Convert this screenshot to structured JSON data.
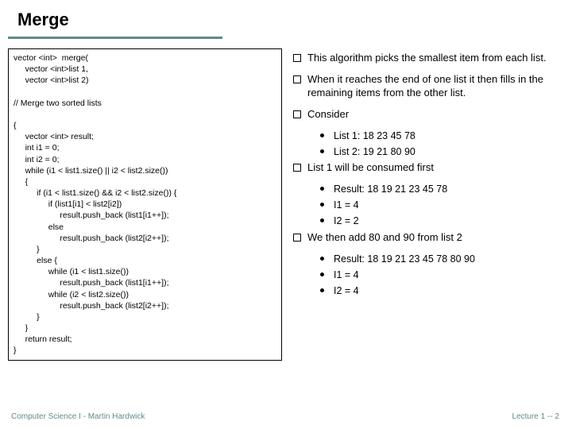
{
  "title": "Merge",
  "code": "vector <int>  merge(\n     vector <int>list 1,\n     vector <int>list 2)\n\n// Merge two sorted lists\n\n{\n     vector <int> result;\n     int i1 = 0;\n     int i2 = 0;\n     while (i1 < list1.size() || i2 < list2.size())\n     {\n          if (i1 < list1.size() && i2 < list2.size()) {\n               if (list1[i1] < list2[i2])\n                    result.push_back (list1[i1++]);\n               else\n                    result.push_back (list2[i2++]);\n          }\n          else {\n               while (i1 < list1.size())\n                    result.push_back (list1[i1++]);\n               while (i2 < list2.size())\n                    result.push_back (list2[i2++]);\n          }\n     }\n     return result;\n}",
  "bullets": [
    {
      "type": "l1",
      "text": "This algorithm picks the smallest item from each list."
    },
    {
      "type": "l1",
      "text": "When it reaches the end of one list it then fills in the remaining items from the other list."
    },
    {
      "type": "l1",
      "text": "Consider"
    },
    {
      "type": "l2",
      "text": "List 1: 18 23 45 78"
    },
    {
      "type": "l2",
      "text": "List 2: 19 21 80 90"
    },
    {
      "type": "l1",
      "text": "List 1 will be consumed first"
    },
    {
      "type": "l2",
      "text": "Result: 18 19 21 23 45 78"
    },
    {
      "type": "l2",
      "text": "I1 = 4"
    },
    {
      "type": "l2",
      "text": "I2 = 2"
    },
    {
      "type": "l1",
      "text": "We then add 80 and 90 from list 2"
    },
    {
      "type": "l2",
      "text": "Result: 18 19 21 23 45 78 80 90"
    },
    {
      "type": "l2",
      "text": "I1 = 4"
    },
    {
      "type": "l2",
      "text": "I2 = 4"
    }
  ],
  "footer_left": "Computer Science I - Martin Hardwick",
  "footer_right": "Lecture 1   --   2"
}
